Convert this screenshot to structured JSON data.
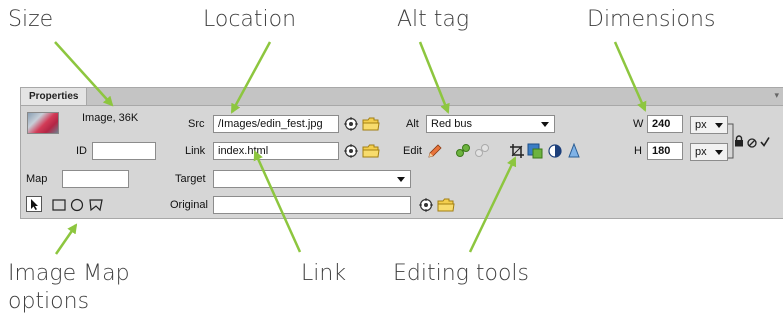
{
  "callouts": {
    "size": "Size",
    "location": "Location",
    "alt_tag": "Alt tag",
    "dimensions": "Dimensions",
    "image_map_line1": "Image Map",
    "image_map_line2": "options",
    "link": "Link",
    "editing_tools": "Editing tools"
  },
  "panel": {
    "tab_label": "Properties",
    "image_size": "Image, 36K",
    "id_label": "ID",
    "id_value": "",
    "src_label": "Src",
    "src_value": "/Images/edin_fest.jpg",
    "link_label": "Link",
    "link_value": "index.html",
    "alt_label": "Alt",
    "alt_value": "Red bus",
    "edit_label": "Edit",
    "w_label": "W",
    "w_value": "240",
    "h_label": "H",
    "h_value": "180",
    "unit_value": "px",
    "map_label": "Map",
    "map_value": "",
    "target_label": "Target",
    "target_value": "",
    "original_label": "Original",
    "original_value": ""
  },
  "colors": {
    "arrow": "#8dc63f",
    "panel_bg": "#d6d6d6"
  }
}
